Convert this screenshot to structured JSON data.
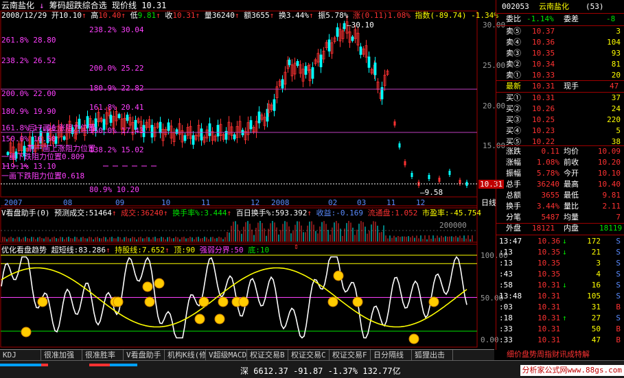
{
  "header": {
    "stock_name": "云南盐化",
    "indicator_name": "筹码超跌综合选",
    "price_line_label": "现价线",
    "price_line_value": "10.31"
  },
  "quote_bar": {
    "date": "2008/12/29",
    "open_label": "开",
    "open": "10.10",
    "high_label": "高",
    "high": "10.40",
    "low_label": "低",
    "low": "9.81",
    "close_label": "收",
    "close": "10.31",
    "vol_label": "量",
    "vol": "36240",
    "amount_label": "额",
    "amount": "3655",
    "turnover_label": "换",
    "turnover": "3.44%",
    "amplitude_label": "振",
    "amplitude": "5.78%",
    "change_label": "涨",
    "change": "(0.11)",
    "change_pct": "1.08%",
    "index_label": "指数",
    "index_value": "(-89.74)",
    "index_pct": "-1.34%"
  },
  "price_axis": [
    "30.00",
    "25.00",
    "20.00",
    "15.00",
    "10.31"
  ],
  "price_annotations": {
    "high_marker": "30.10",
    "low_marker": "9.58",
    "current_box": "10.31"
  },
  "fib_levels": [
    {
      "text": "238.2% 30.04"
    },
    {
      "text": "261.8% 28.80"
    },
    {
      "text": "238.2% 26.52"
    },
    {
      "text": "200.0% 25.22"
    },
    {
      "text": "200.0% 22.00"
    },
    {
      "text": "180.9% 22.82"
    },
    {
      "text": "180.9% 19.90"
    },
    {
      "text": "161.8% 20.41"
    },
    {
      "text": "161.8% 17.06"
    },
    {
      "text": "150.0% 16.50"
    },
    {
      "text": "150.0% 17.43"
    },
    {
      "text": "138.2% 15.02"
    },
    {
      "text": "119.1% 13.10"
    },
    {
      "text": "80.9% 10.20"
    }
  ],
  "fib_notes": [
    "后一画上涨阻力位置",
    "前一画上涨阻力位置",
    "一画下跌阻力位置0.809",
    "一画下跌阻力位置0.618"
  ],
  "date_axis": [
    "2007",
    "08",
    "09",
    "10",
    "11",
    "12",
    "2008",
    "02",
    "03",
    "11",
    "12",
    "日线"
  ],
  "vol_bar": {
    "title": "V看盘助手(0)",
    "forecast_label": "预测成交:",
    "forecast": "51464",
    "deal_label": "成交:",
    "deal": "36240",
    "turnover_label": "换手率%:",
    "turnover": "3.444",
    "hundred_label": "百日换手%:",
    "hundred": "593.392",
    "income_label": "收益:",
    "income": "-0.169",
    "float_label": "流通盘:",
    "float": "1.052",
    "pe_label": "市盈率:",
    "pe": "-45.754",
    "axis_label": "200000"
  },
  "osc_bar": {
    "title": "优化看盘趋势",
    "super_label": "超短线:",
    "super": "83.286",
    "hold_label": "持股线:",
    "hold": "7.652",
    "top_label": "顶:",
    "top": "90",
    "strong_label": "强弱分界:",
    "strong": "50",
    "bottom_label": "底:",
    "bottom": "10",
    "axis": [
      "100.00",
      "50.00",
      "0.00"
    ]
  },
  "tabs": [
    "KDJ",
    "很准加强",
    "很准胜率",
    "V看盘助手",
    "机构K线(修",
    "V超级MACD",
    "权证交易B",
    "权证交易C",
    "权证交易F",
    "日分隔线",
    "狐狸出击"
  ],
  "right_panel": {
    "code": "002053",
    "name": "云南盐化",
    "rank": "(53)",
    "wb_label": "委比",
    "wb_value": "-1.14%",
    "wc_label": "委差",
    "wc_value": "-8",
    "asks": [
      {
        "label": "卖⑤",
        "price": "10.37",
        "vol": "3"
      },
      {
        "label": "卖④",
        "price": "10.36",
        "vol": "104"
      },
      {
        "label": "卖③",
        "price": "10.35",
        "vol": "93"
      },
      {
        "label": "卖②",
        "price": "10.34",
        "vol": "81"
      },
      {
        "label": "卖①",
        "price": "10.33",
        "vol": "20"
      }
    ],
    "last_label": "最新",
    "last_value": "10.31",
    "cur_label": "现手",
    "cur_value": "47",
    "bids": [
      {
        "label": "买①",
        "price": "10.31",
        "vol": "37"
      },
      {
        "label": "买②",
        "price": "10.26",
        "vol": "24"
      },
      {
        "label": "买③",
        "price": "10.25",
        "vol": "220"
      },
      {
        "label": "买④",
        "price": "10.23",
        "vol": "5"
      },
      {
        "label": "买⑤",
        "price": "10.22",
        "vol": "38"
      }
    ],
    "stats": [
      {
        "l1": "涨跌",
        "v1": "0.11",
        "l2": "均价",
        "v2": "10.09"
      },
      {
        "l1": "涨幅",
        "v1": "1.08%",
        "l2": "前收",
        "v2": "10.20"
      },
      {
        "l1": "振幅",
        "v1": "5.78%",
        "l2": "今开",
        "v2": "10.10"
      },
      {
        "l1": "总手",
        "v1": "36240",
        "l2": "最高",
        "v2": "10.40"
      },
      {
        "l1": "总额",
        "v1": "3655",
        "l2": "最低",
        "v2": "9.81"
      },
      {
        "l1": "换手",
        "v1": "3.44%",
        "l2": "量比",
        "v2": "2.11"
      },
      {
        "l1": "分笔",
        "v1": "5487",
        "l2": "均量",
        "v2": "7"
      }
    ],
    "outer_label": "外盘",
    "outer_value": "18121",
    "inner_label": "内盘",
    "inner_value": "18119",
    "ticks": [
      {
        "time": "13:47",
        "price": "10.36",
        "dir": "↓",
        "vol": "172",
        "side": "S"
      },
      {
        "time": ":13",
        "price": "10.35",
        "dir": "↓",
        "vol": "21",
        "side": "S"
      },
      {
        "time": ":13",
        "price": "10.35",
        "dir": "",
        "vol": "3",
        "side": "S"
      },
      {
        "time": ":43",
        "price": "10.35",
        "dir": "",
        "vol": "4",
        "side": "S"
      },
      {
        "time": ":58",
        "price": "10.31",
        "dir": "↓",
        "vol": "16",
        "side": "S"
      },
      {
        "time": "13:48",
        "price": "10.31",
        "dir": "",
        "vol": "105",
        "side": "S"
      },
      {
        "time": ":03",
        "price": "10.31",
        "dir": "",
        "vol": "31",
        "side": "B"
      },
      {
        "time": ":18",
        "price": "10.31",
        "dir": "↑",
        "vol": "27",
        "side": "S"
      },
      {
        "time": ":33",
        "price": "10.31",
        "dir": "",
        "vol": "50",
        "side": "B"
      },
      {
        "time": ":33",
        "price": "10.31",
        "dir": "",
        "vol": "47",
        "side": "B"
      }
    ],
    "bottom_tabs": [
      "细",
      "价",
      "盘",
      "势",
      "周",
      "指",
      "财",
      "讯",
      "成",
      "特",
      "解"
    ]
  },
  "status": {
    "market": "深",
    "index": "6612.37",
    "change": "-91.87",
    "pct": "-1.37%",
    "amount": "132.77亿",
    "site": "分析家公式网www.88gs.com"
  },
  "colors": {
    "up": "#ff3232",
    "down": "#00e600",
    "fib": "#ff40ff",
    "bg": "#000000"
  }
}
